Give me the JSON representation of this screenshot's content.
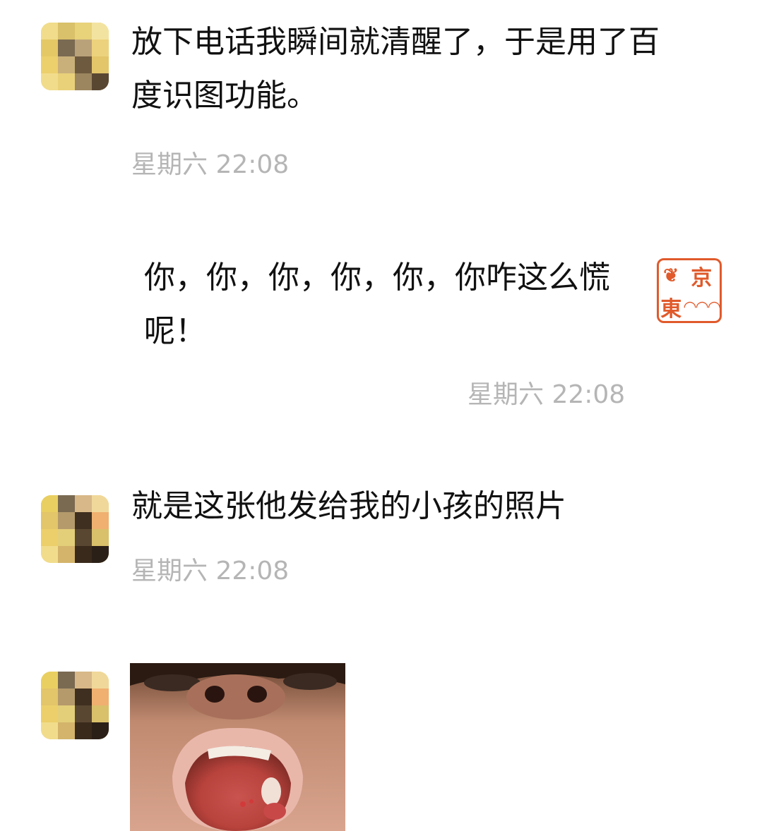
{
  "messages": [
    {
      "sender": "them",
      "text": "放下电话我瞬间就清醒了，于是用了百度识图功能。",
      "time": "星期六 22:08"
    },
    {
      "sender": "me",
      "text": "你，你，你，你，你，你咋这么慌呢！",
      "time": "星期六 22:08"
    },
    {
      "sender": "them",
      "text": "就是这张他发给我的小孩的照片",
      "time": "星期六 22:08"
    }
  ],
  "my_avatar": {
    "type": "red seal",
    "color": "#e05a2b",
    "glyphs": [
      "京",
      "東"
    ]
  },
  "contact_avatar": {
    "type": "pixelated mosaic",
    "base_color": "#e9cf61"
  },
  "photo_message": {
    "content": "close-up photo of a child's open mouth"
  }
}
